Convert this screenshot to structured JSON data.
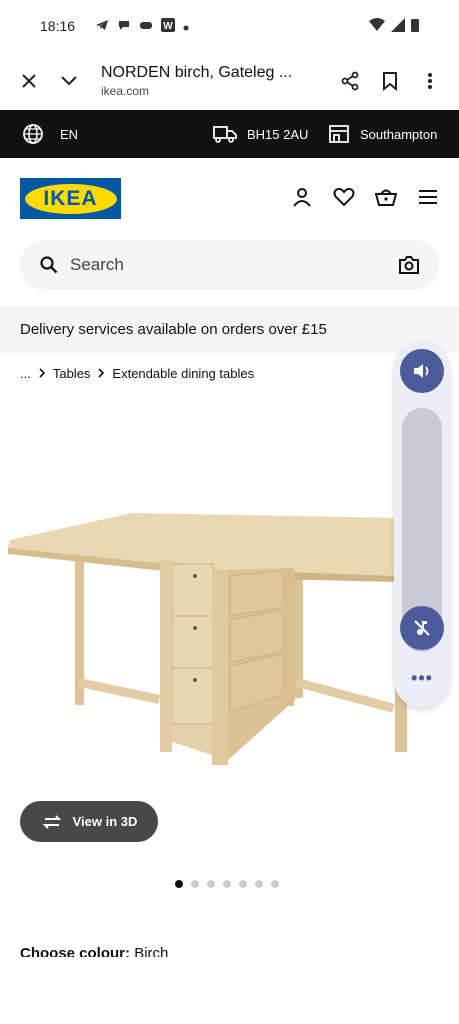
{
  "status": {
    "time": "18:16"
  },
  "browser": {
    "title": "NORDEN birch, Gateleg ...",
    "host": "ikea.com"
  },
  "topstrip": {
    "language": "EN",
    "postcode": "BH15 2AU",
    "store": "Southampton"
  },
  "header": {
    "logo_text": "IKEA"
  },
  "search": {
    "placeholder": "Search"
  },
  "banner": {
    "delivery_text": "Delivery services available on orders over £15"
  },
  "breadcrumb": {
    "ellipsis": "...",
    "items": [
      "Tables",
      "Extendable dining tables"
    ]
  },
  "product": {
    "view3d_label": "View in 3D",
    "image_count": 7,
    "active_image": 1,
    "colour_label": "Choose colour:",
    "colour_value": "Birch"
  },
  "colors": {
    "ikea_blue": "#0058a3",
    "ikea_yellow": "#ffdb00",
    "volume_accent": "#4c5b99"
  }
}
